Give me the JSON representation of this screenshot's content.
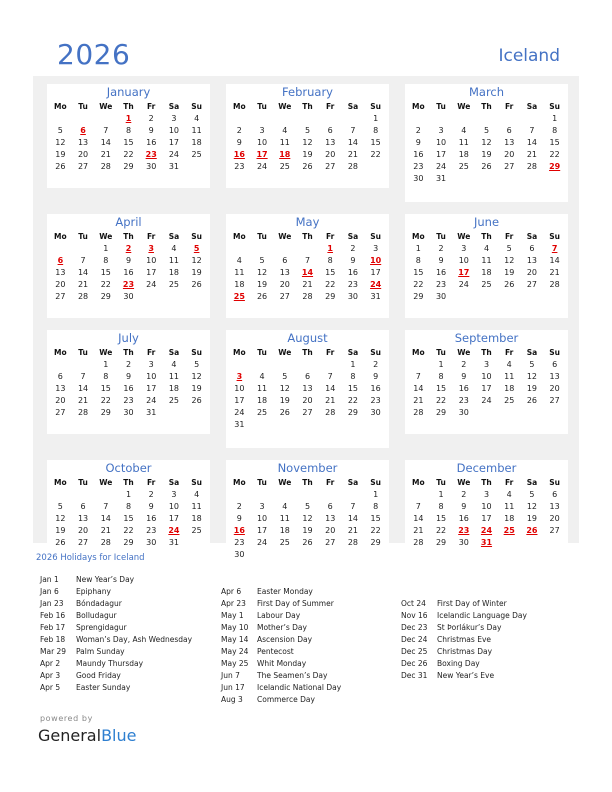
{
  "header": {
    "year": "2026",
    "country": "Iceland"
  },
  "weekdays": [
    "Mo",
    "Tu",
    "We",
    "Th",
    "Fr",
    "Sa",
    "Su"
  ],
  "colors": {
    "accent": "#4472c4",
    "holiday": "#e00000",
    "panel": "#f0f0f0"
  },
  "months": [
    {
      "name": "January",
      "offset": 3,
      "days": 31,
      "holidays": [
        1,
        6,
        23
      ]
    },
    {
      "name": "February",
      "offset": 6,
      "days": 28,
      "holidays": [
        16,
        17,
        18
      ]
    },
    {
      "name": "March",
      "offset": 6,
      "days": 31,
      "holidays": [
        29
      ]
    },
    {
      "name": "April",
      "offset": 2,
      "days": 30,
      "holidays": [
        2,
        3,
        5,
        6,
        23
      ]
    },
    {
      "name": "May",
      "offset": 4,
      "days": 31,
      "holidays": [
        1,
        10,
        14,
        24,
        25
      ]
    },
    {
      "name": "June",
      "offset": 0,
      "days": 30,
      "holidays": [
        7,
        17
      ]
    },
    {
      "name": "July",
      "offset": 2,
      "days": 31,
      "holidays": []
    },
    {
      "name": "August",
      "offset": 5,
      "days": 31,
      "holidays": [
        3
      ]
    },
    {
      "name": "September",
      "offset": 1,
      "days": 30,
      "holidays": []
    },
    {
      "name": "October",
      "offset": 3,
      "days": 31,
      "holidays": [
        24
      ]
    },
    {
      "name": "November",
      "offset": 6,
      "days": 30,
      "holidays": [
        16
      ]
    },
    {
      "name": "December",
      "offset": 1,
      "days": 31,
      "holidays": [
        23,
        24,
        25,
        26,
        31
      ]
    }
  ],
  "holidays_title": "2026 Holidays for Iceland",
  "holiday_columns": [
    [
      {
        "date": "Jan 1",
        "name": "New Year’s Day"
      },
      {
        "date": "Jan 6",
        "name": "Epiphany"
      },
      {
        "date": "Jan 23",
        "name": "Bóndadagur"
      },
      {
        "date": "Feb 16",
        "name": "Bolludagur"
      },
      {
        "date": "Feb 17",
        "name": "Sprengidagur"
      },
      {
        "date": "Feb 18",
        "name": "Woman’s Day, Ash Wednesday"
      },
      {
        "date": "Mar 29",
        "name": "Palm Sunday"
      },
      {
        "date": "Apr 2",
        "name": "Maundy Thursday"
      },
      {
        "date": "Apr 3",
        "name": "Good Friday"
      },
      {
        "date": "Apr 5",
        "name": "Easter Sunday"
      }
    ],
    [
      {
        "date": "Apr 6",
        "name": "Easter Monday"
      },
      {
        "date": "Apr 23",
        "name": "First Day of Summer"
      },
      {
        "date": "May 1",
        "name": "Labour Day"
      },
      {
        "date": "May 10",
        "name": "Mother’s Day"
      },
      {
        "date": "May 14",
        "name": "Ascension Day"
      },
      {
        "date": "May 24",
        "name": "Pentecost"
      },
      {
        "date": "May 25",
        "name": "Whit Monday"
      },
      {
        "date": "Jun 7",
        "name": "The Seamen’s Day"
      },
      {
        "date": "Jun 17",
        "name": "Icelandic National Day"
      },
      {
        "date": "Aug 3",
        "name": "Commerce Day"
      }
    ],
    [
      {
        "date": "Oct 24",
        "name": "First Day of Winter"
      },
      {
        "date": "Nov 16",
        "name": "Icelandic Language Day"
      },
      {
        "date": "Dec 23",
        "name": "St Þorlákur’s Day"
      },
      {
        "date": "Dec 24",
        "name": "Christmas Eve"
      },
      {
        "date": "Dec 25",
        "name": "Christmas Day"
      },
      {
        "date": "Dec 26",
        "name": "Boxing Day"
      },
      {
        "date": "Dec 31",
        "name": "New Year’s Eve"
      }
    ]
  ],
  "footer": {
    "powered_by": "powered by",
    "brand_general": "General",
    "brand_blue": "Blue"
  }
}
